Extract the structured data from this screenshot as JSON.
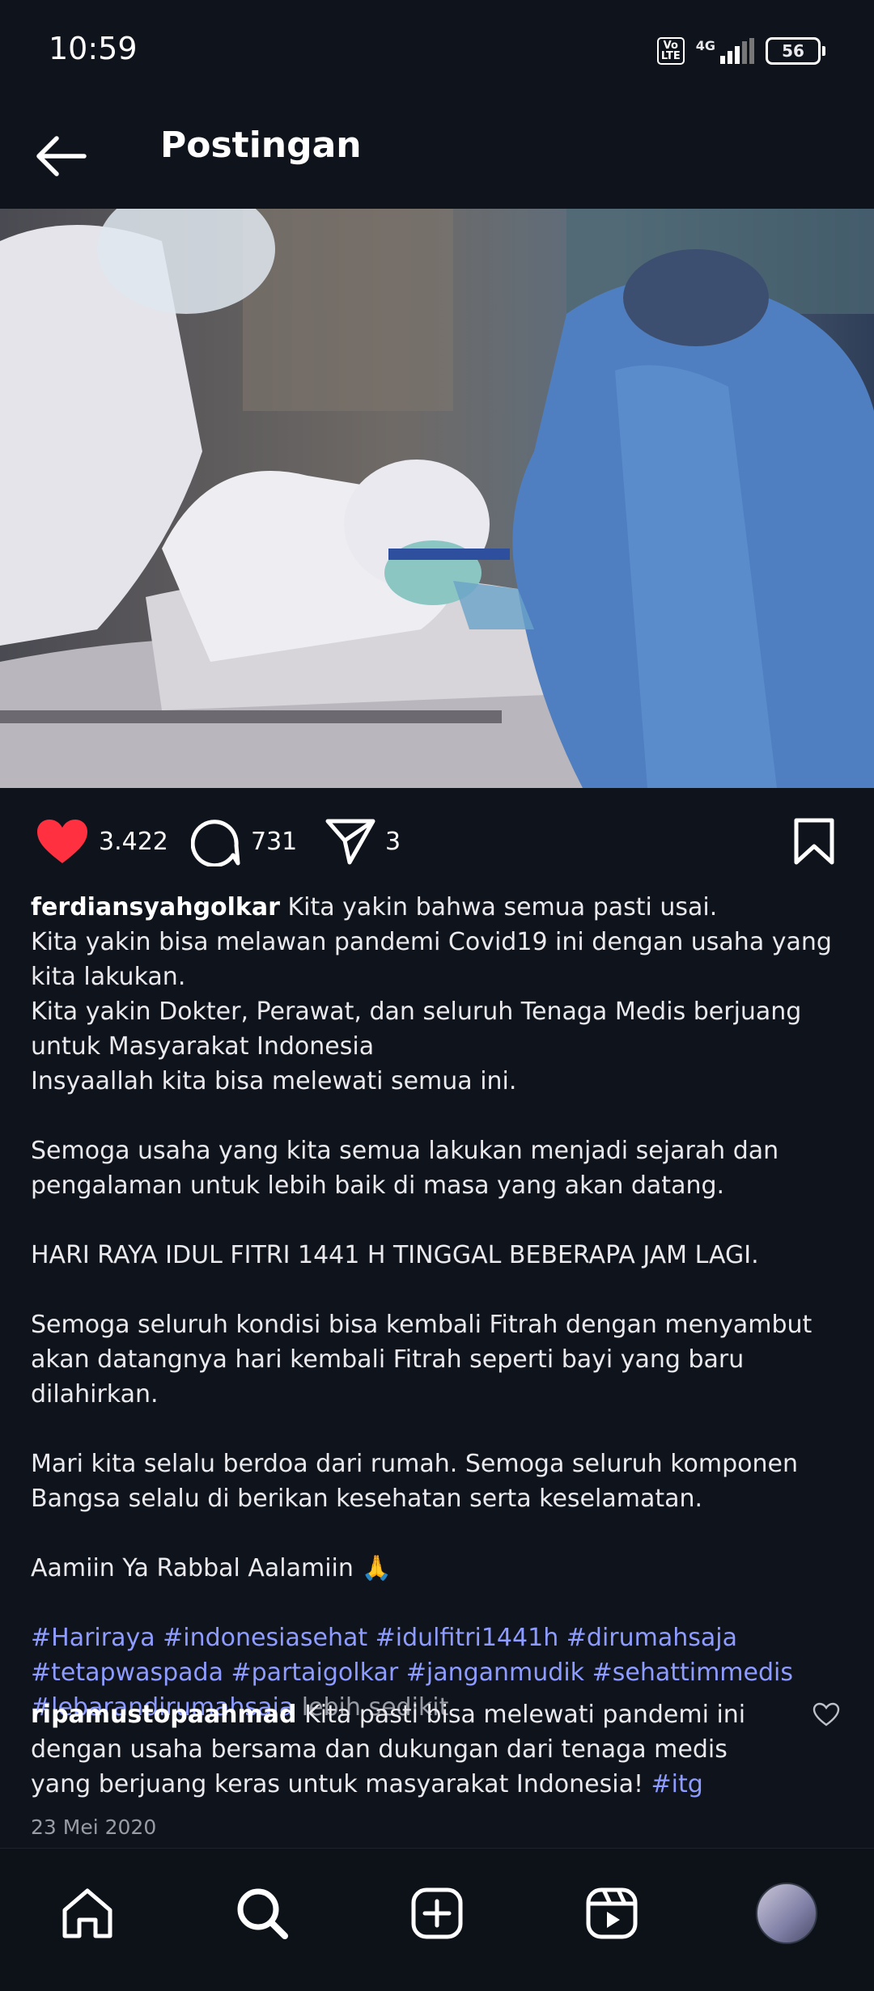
{
  "status_bar": {
    "time": "10:59",
    "network": "4G",
    "volte": "Vo\nLTE",
    "battery": "56"
  },
  "header": {
    "title": "Postingan"
  },
  "post": {
    "image_alt": "medical-workers-photo",
    "likes": "3.422",
    "comments": "731",
    "shares": "3",
    "username": "ferdiansyahgolkar",
    "caption_lines": [
      "Kita yakin bahwa semua pasti usai.",
      "Kita yakin bisa melawan pandemi Covid19 ini dengan usaha yang kita lakukan.",
      "Kita yakin Dokter, Perawat, dan seluruh Tenaga Medis berjuang untuk Masyarakat Indonesia",
      "Insyaallah kita bisa melewati semua ini."
    ],
    "paragraph_2": "Semoga usaha yang kita semua lakukan menjadi sejarah dan pengalaman untuk lebih baik di masa yang akan datang.",
    "paragraph_3": "HARI RAYA IDUL FITRI 1441 H TINGGAL BEBERAPA JAM LAGI.",
    "paragraph_4": "Semoga seluruh kondisi bisa kembali Fitrah dengan menyambut akan datangnya hari kembali Fitrah seperti bayi yang baru dilahirkan.",
    "paragraph_5": "Mari kita selalu berdoa dari rumah. Semoga seluruh komponen Bangsa selalu di berikan kesehatan serta keselamatan.",
    "paragraph_6": "Aamiin Ya Rabbal Aalamiin 🙏",
    "hashtags": [
      "#Hariraya",
      "#indonesiasehat",
      "#idulfitri1441h",
      "#dirumahsaja",
      "#tetapwaspada",
      "#partaigolkar",
      "#janganmudik",
      "#sehattimmedis",
      "#lebarandirumahsaja"
    ],
    "more_label": "lebih sedikit",
    "comment": {
      "username": "ripamustopaahmad",
      "text": "Kita pasti bisa melewati pandemi ini dengan usaha bersama dan dukungan dari tenaga medis yang berjuang keras untuk masyarakat Indonesia!",
      "tag": "#itg"
    },
    "date": "23 Mei 2020"
  },
  "nav": [
    "home-icon",
    "search-icon",
    "create-icon",
    "reels-icon",
    "profile-avatar"
  ],
  "colors": {
    "background": "#0f131b",
    "like": "#ff3040",
    "hashtag": "#8e9cff",
    "muted": "#9a9ca5"
  }
}
